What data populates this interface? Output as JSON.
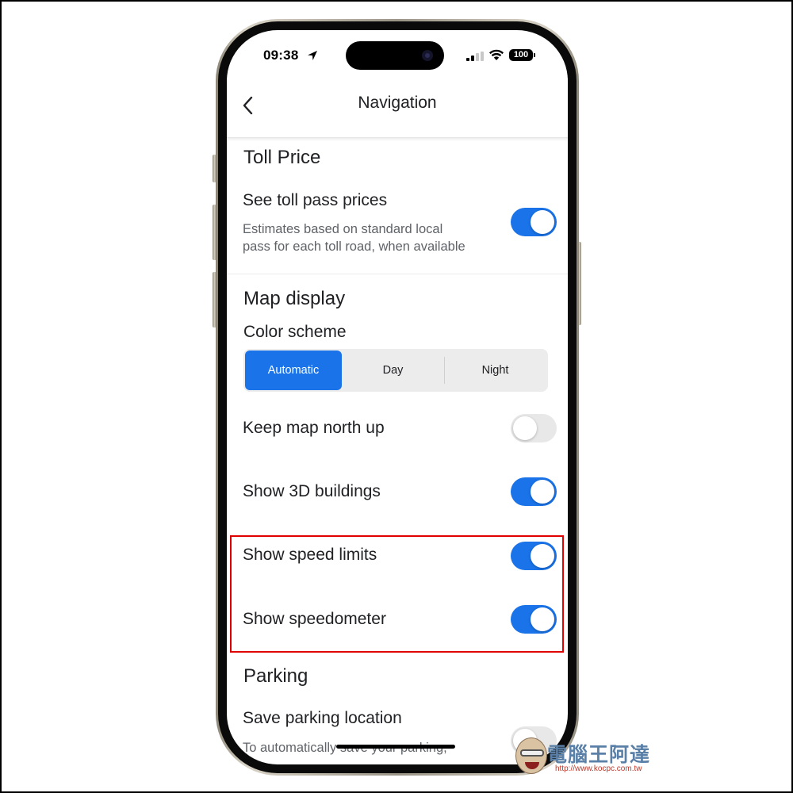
{
  "status_bar": {
    "time": "09:38",
    "battery": "100",
    "icons": [
      "location-arrow-icon",
      "signal-icon",
      "wifi-icon",
      "battery-icon"
    ]
  },
  "header": {
    "title": "Navigation",
    "back_icon": "chevron-left-icon"
  },
  "sections": {
    "toll": {
      "title": "Toll Price",
      "see_toll": {
        "label": "See toll pass prices",
        "subtitle_line1": "Estimates based on standard local",
        "subtitle_line2": "pass for each toll road, when available",
        "enabled": true
      }
    },
    "map_display": {
      "title": "Map display",
      "color_scheme": {
        "label": "Color scheme",
        "options": [
          "Automatic",
          "Day",
          "Night"
        ],
        "selected": "Automatic"
      },
      "keep_north_up": {
        "label": "Keep map north up",
        "enabled": false
      },
      "show_3d": {
        "label": "Show 3D buildings",
        "enabled": true
      },
      "speed_limits": {
        "label": "Show speed limits",
        "enabled": true
      },
      "speedometer": {
        "label": "Show speedometer",
        "enabled": true
      }
    },
    "parking": {
      "title": "Parking",
      "save_parking": {
        "label": "Save parking location",
        "subtitle_line1": "To automatically save your parking,",
        "enabled": false
      }
    }
  },
  "colors": {
    "accent": "#1a73e8",
    "toggle_off": "#e8e8e8",
    "highlight": "#e00000"
  },
  "watermark": {
    "title": "電腦王阿達",
    "url": "http://www.kocpc.com.tw"
  }
}
